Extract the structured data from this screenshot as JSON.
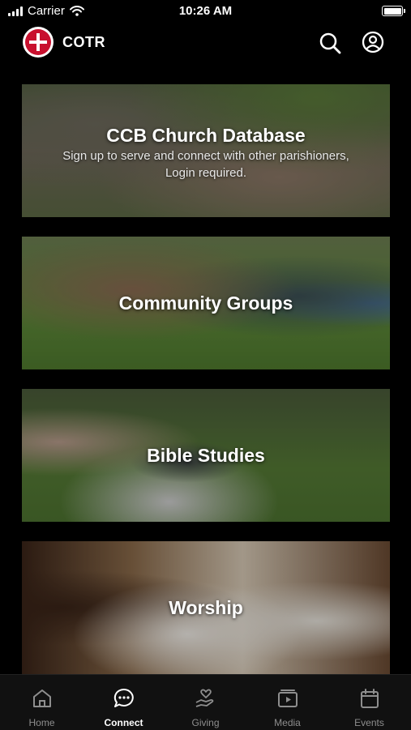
{
  "status_bar": {
    "carrier": "Carrier",
    "time": "10:26 AM"
  },
  "header": {
    "title": "COTR",
    "search_icon": "search-icon",
    "account_icon": "account-circle-icon",
    "accent": "#c8102e"
  },
  "cards": [
    {
      "title": "CCB Church Database",
      "subtitle": "Sign up to serve and connect with other parishioners, Login required."
    },
    {
      "title": "Community Groups"
    },
    {
      "title": "Bible Studies"
    },
    {
      "title": "Worship"
    }
  ],
  "tabs": [
    {
      "label": "Home",
      "icon": "home-icon",
      "active": false
    },
    {
      "label": "Connect",
      "icon": "chat-bubble-icon",
      "active": true
    },
    {
      "label": "Giving",
      "icon": "hand-heart-icon",
      "active": false
    },
    {
      "label": "Media",
      "icon": "play-media-icon",
      "active": false
    },
    {
      "label": "Events",
      "icon": "calendar-icon",
      "active": false
    }
  ]
}
